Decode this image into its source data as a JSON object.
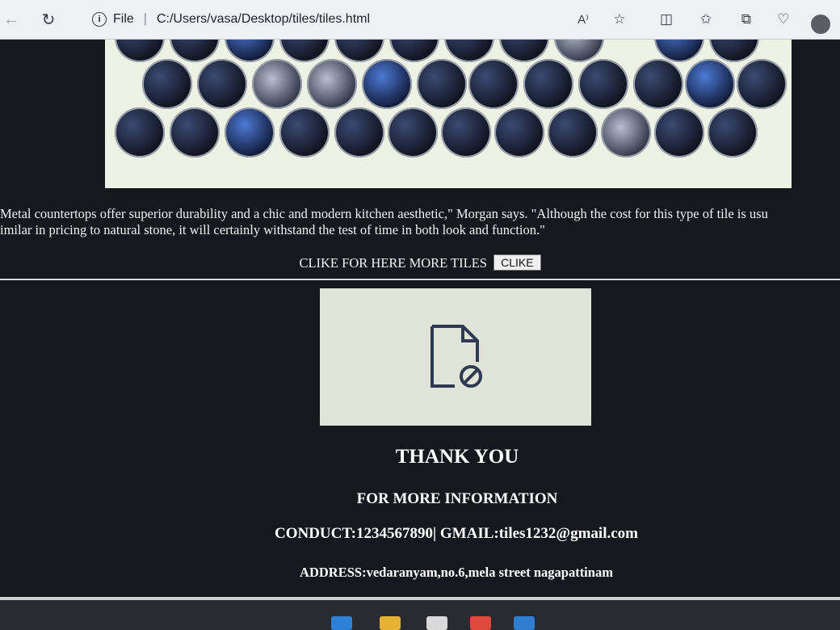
{
  "browser": {
    "file_label": "File",
    "url": "C:/Users/vasa/Desktop/tiles/tiles.html",
    "read_aloud_label": "A⁾"
  },
  "content": {
    "paragraph_line1": "Metal countertops offer superior durability and a chic and modern kitchen aesthetic,\" Morgan says. \"Although the cost for this type of tile is usu",
    "paragraph_line2": "imilar in pricing to natural stone, it will certainly withstand the test of time in both look and function.\"",
    "more_tiles_text": "CLIKE FOR HERE MORE TILES",
    "more_tiles_button": "CLIKE",
    "thank_you": "THANK YOU",
    "more_info": "FOR MORE INFORMATION",
    "contact": "CONDUCT:1234567890| GMAIL:tiles1232@gmail.com",
    "address": "ADDRESS:vedaranyam,no.6,mela street nagapattinam"
  },
  "icons": {
    "back": "back-arrow-icon",
    "refresh": "refresh-icon",
    "info": "info-icon",
    "favorite": "star-icon",
    "split": "split-screen-icon",
    "favorites_list": "favorites-list-icon",
    "collections": "collections-icon",
    "heart": "browser-essentials-icon",
    "broken_image": "broken-image-icon"
  },
  "colors": {
    "page_bg": "#17181e",
    "text": "#f1f1f1",
    "toolbar_bg": "#eef0f3"
  }
}
